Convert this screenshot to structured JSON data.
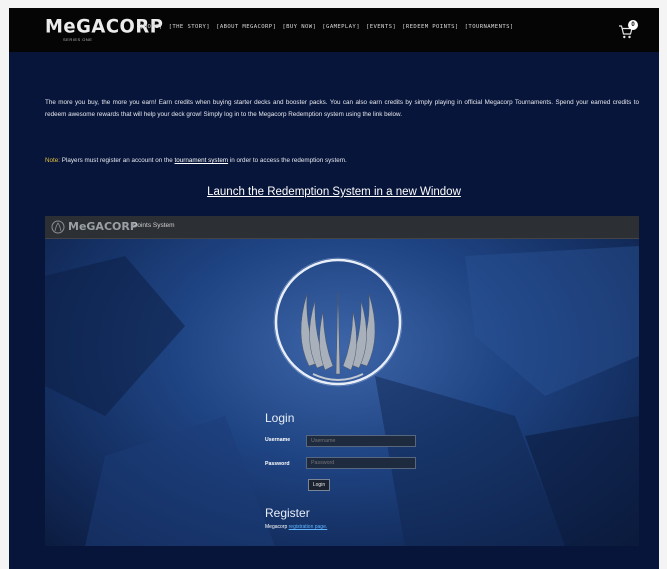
{
  "header": {
    "logo_text": "MeGACORP",
    "logo_subtext": "SERIES ONE",
    "nav": [
      {
        "label": "[HOME]"
      },
      {
        "label": "[THE STORY]"
      },
      {
        "label": "[ABOUT MEGACORP]"
      },
      {
        "label": "[BUY NOW]"
      },
      {
        "label": "[GAMEPLAY]"
      },
      {
        "label": "[EVENTS]"
      },
      {
        "label": "[REDEEM POINTS]"
      },
      {
        "label": "[TOURNAMENTS]"
      }
    ],
    "cart_icon": "shopping-cart-icon",
    "cart_count": "0"
  },
  "content": {
    "intro": "The more you buy, the more you earn! Earn credits when buying starter decks and booster packs. You can also earn credits by simply playing in official Megacorp Tournaments. Spend your earned credits to redeem awesome rewards that will help your deck grow! Simply log in to the Megacorp Redemption system using the link below.",
    "note_label": "Note:",
    "note_before": " Players must register an account on the ",
    "note_link": "tournament system",
    "note_after": " in order to access the redemption system.",
    "launch_link": "Launch the Redemption System in a new Window"
  },
  "embed": {
    "logo_text": "MeGACORP",
    "title": "Points System",
    "login_title": "Login",
    "username_label": "Username",
    "username_placeholder": "Username",
    "password_label": "Password",
    "password_placeholder": "Password",
    "login_button": "Login",
    "register_title": "Register",
    "register_prefix": "Megacorp ",
    "register_link": "registration page."
  },
  "colors": {
    "page_bg": "#08153a",
    "topbar_bg": "#050506",
    "note_accent": "#e0c040",
    "register_link": "#5fb5ff"
  }
}
